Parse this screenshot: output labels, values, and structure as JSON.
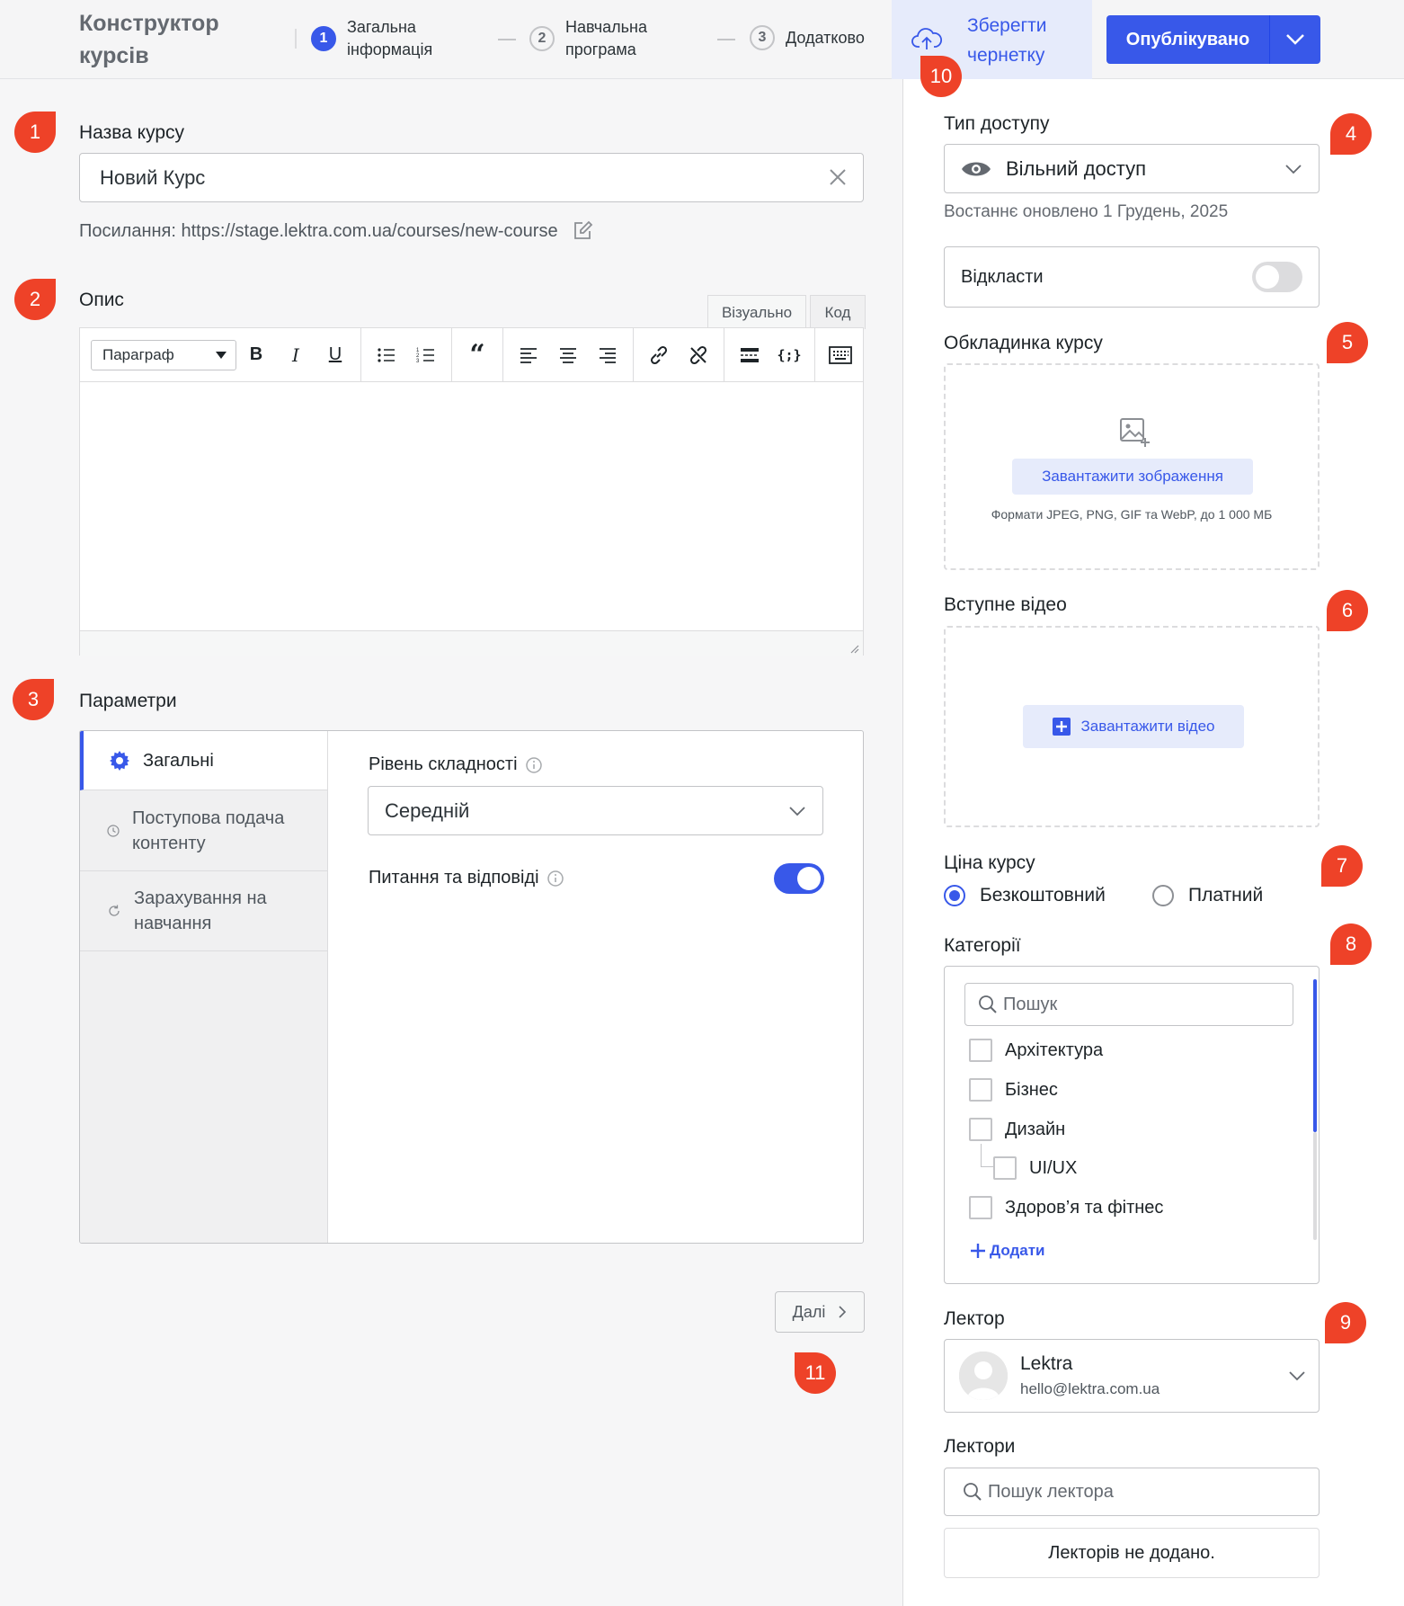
{
  "header": {
    "app_title": "Конструктор курсів",
    "steps": [
      {
        "num": "1",
        "label": "Загальна інформація"
      },
      {
        "num": "2",
        "label": "Навчальна програма"
      },
      {
        "num": "3",
        "label": "Додатково"
      }
    ],
    "save_draft_label": "Зберегти чернетку",
    "publish_label": "Опублікувано"
  },
  "badges": [
    "1",
    "2",
    "3",
    "4",
    "5",
    "6",
    "7",
    "8",
    "9",
    "10",
    "11"
  ],
  "course_name": {
    "label": "Назва курсу",
    "value": "Новий Курс",
    "permalink": "Посилання: https://stage.lektra.com.ua/courses/new-course"
  },
  "description": {
    "label": "Опис",
    "tab_visual": "Візуально",
    "tab_code": "Код",
    "format_select": "Параграф"
  },
  "params": {
    "label": "Параметри",
    "tabs": [
      "Загальні",
      "Поступова подача контенту",
      "Зарахування на навчання"
    ],
    "difficulty_label": "Рівень складності",
    "difficulty_value": "Середній",
    "qa_label": "Питання та відповіді",
    "qa_enabled": true
  },
  "next_label": "Далі",
  "sidebar": {
    "access_label": "Тип доступу",
    "access_value": "Вільний доступ",
    "last_updated": "Востаннє оновлено 1 Грудень, 2025",
    "postpone_label": "Відкласти",
    "postpone_enabled": false,
    "cover_label": "Обкладинка курсу",
    "upload_image_label": "Завантажити зображення",
    "formats_note": "Формати JPEG, PNG, GIF та WebP, до 1 000 МБ",
    "video_label": "Вступне відео",
    "upload_video_label": "Завантажити відео",
    "price_label": "Ціна курсу",
    "price_options": [
      "Безкоштовний",
      "Платний"
    ],
    "categories_label": "Категорії",
    "categories_search_placeholder": "Пошук",
    "categories": [
      "Архітектура",
      "Бізнес",
      "Дизайн",
      "UI/UX",
      "Здоров’я та фітнес"
    ],
    "add_category_label": "Додати",
    "lecturer_label": "Лектор",
    "lecturer_name": "Lektra",
    "lecturer_email": "hello@lektra.com.ua",
    "lecturers_label": "Лектори",
    "lecturers_search_placeholder": "Пошук лектора",
    "no_lecturers": "Лекторів не додано."
  },
  "colors": {
    "accent": "#3858e9",
    "badge": "#ee4228",
    "accent_soft": "#e6ebfb"
  }
}
